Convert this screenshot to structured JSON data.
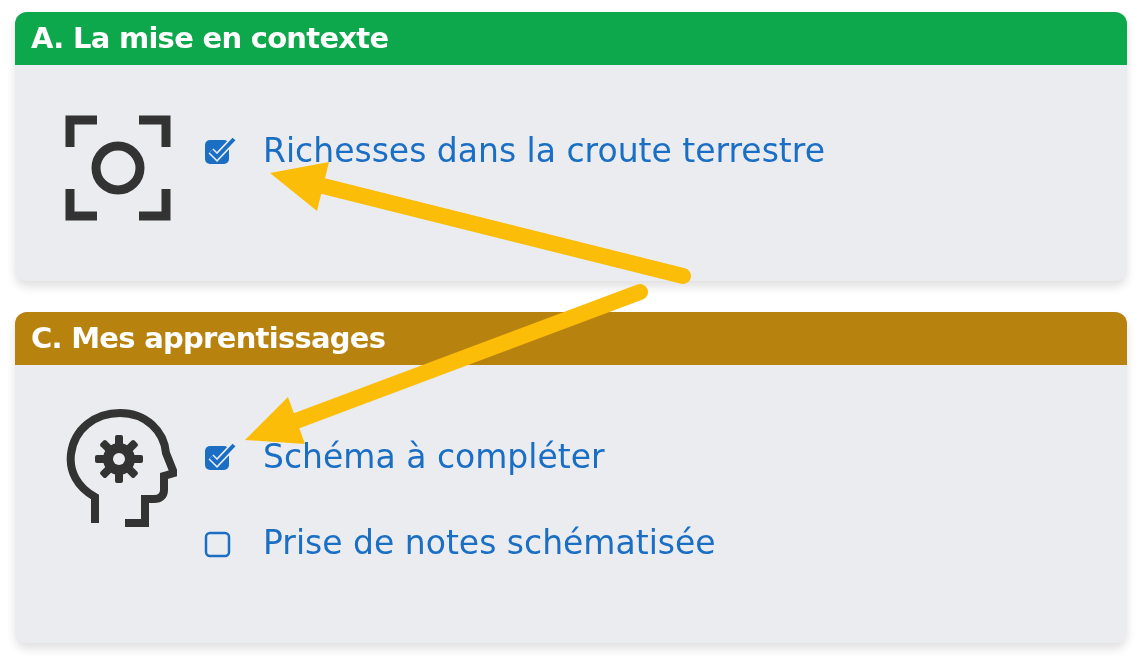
{
  "sections": [
    {
      "title": "A. La mise en contexte",
      "color": "#0ea84c",
      "kind": "focus",
      "items": [
        {
          "label": "Richesses dans la croute terrestre",
          "checked": true
        }
      ]
    },
    {
      "title": "C. Mes apprentissages",
      "color": "#b8820e",
      "kind": "head",
      "items": [
        {
          "label": "Schéma à compléter",
          "checked": true
        },
        {
          "label": "Prise de notes schématisée",
          "checked": false
        }
      ]
    }
  ]
}
